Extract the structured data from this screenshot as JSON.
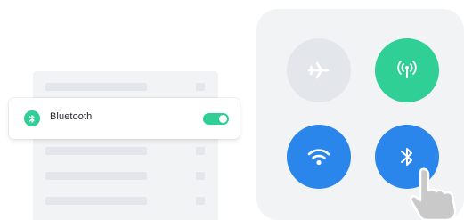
{
  "settings": {
    "bluetooth_row": {
      "label": "Bluetooth",
      "toggle": "on"
    }
  },
  "control_center": {
    "tiles": [
      {
        "name": "airplane-mode",
        "icon": "airplane-icon",
        "state": "off"
      },
      {
        "name": "hotspot",
        "icon": "hotspot-icon",
        "state": "on"
      },
      {
        "name": "wifi",
        "icon": "wifi-icon",
        "state": "on"
      },
      {
        "name": "bluetooth",
        "icon": "bluetooth-icon",
        "state": "on"
      }
    ]
  },
  "colors": {
    "green": "#2fcf95",
    "blue": "#2a86ea",
    "tile_off": "#e3e6ea",
    "panel": "#f1f3f5"
  },
  "icons": {
    "pointer": "hand-pointer-icon"
  }
}
